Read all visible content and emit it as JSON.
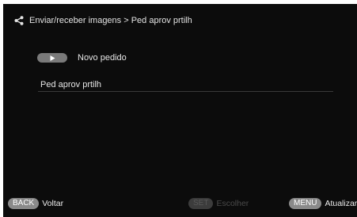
{
  "header": {
    "share_icon": "share-icon",
    "title": "Enviar/receber imagens > Ped aprov prtilh"
  },
  "new_order": {
    "button_icon": "play-icon",
    "label": "Novo pedido"
  },
  "list": {
    "items": [
      {
        "label": "Ped aprov prtilh"
      }
    ]
  },
  "footer": {
    "back": {
      "key": "BACK",
      "label": "Voltar"
    },
    "set": {
      "key": "SET",
      "label": "Escolher",
      "enabled": false
    },
    "menu": {
      "key": "MENU",
      "label": "Atualizar"
    }
  },
  "colors": {
    "screen_background": "#0c0c0c",
    "text": "#e6e6e6",
    "pill_active": "#8a8a8a",
    "pill_disabled": "#3c3c3c"
  }
}
